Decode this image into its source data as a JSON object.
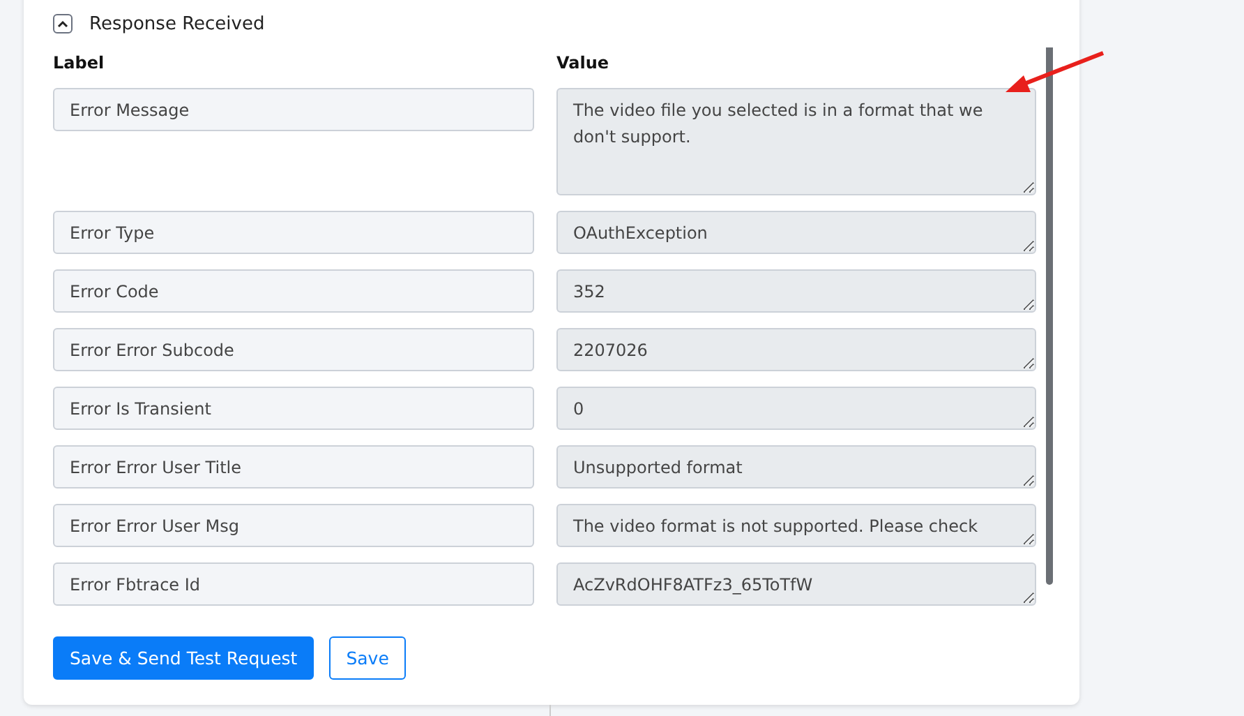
{
  "section": {
    "title": "Response Received",
    "expanded": true
  },
  "columns": [
    "Label",
    "Value"
  ],
  "rows": [
    {
      "label": "Error Message",
      "value": "The video file you selected is in a format that we don't support.",
      "kind": "tall"
    },
    {
      "label": "Error Type",
      "value": "OAuthException",
      "kind": "short"
    },
    {
      "label": "Error Code",
      "value": "352",
      "kind": "short"
    },
    {
      "label": "Error Error Subcode",
      "value": "2207026",
      "kind": "short"
    },
    {
      "label": "Error Is Transient",
      "value": "0",
      "kind": "short"
    },
    {
      "label": "Error Error User Title",
      "value": "Unsupported format",
      "kind": "short"
    },
    {
      "label": "Error Error User Msg",
      "value": "The video format is not supported. Please check",
      "kind": "scroll"
    },
    {
      "label": "Error Fbtrace Id",
      "value": "AcZvRdOHF8ATFz3_65ToTfW",
      "kind": "short"
    }
  ],
  "buttons": [
    {
      "label": "Save & Send Test Request",
      "kind": "primary"
    },
    {
      "label": "Save",
      "kind": "outline"
    }
  ]
}
